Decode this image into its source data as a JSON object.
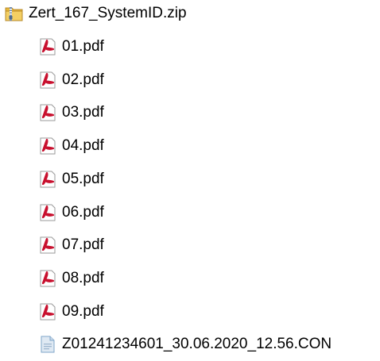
{
  "archive": {
    "name": "Zert_167_SystemID.zip",
    "icon": "zip-folder-icon"
  },
  "files": [
    {
      "name": "01.pdf",
      "icon": "pdf-file-icon"
    },
    {
      "name": "02.pdf",
      "icon": "pdf-file-icon"
    },
    {
      "name": "03.pdf",
      "icon": "pdf-file-icon"
    },
    {
      "name": "04.pdf",
      "icon": "pdf-file-icon"
    },
    {
      "name": "05.pdf",
      "icon": "pdf-file-icon"
    },
    {
      "name": "06.pdf",
      "icon": "pdf-file-icon"
    },
    {
      "name": "07.pdf",
      "icon": "pdf-file-icon"
    },
    {
      "name": "08.pdf",
      "icon": "pdf-file-icon"
    },
    {
      "name": "09.pdf",
      "icon": "pdf-file-icon"
    },
    {
      "name": "Z01241234601_30.06.2020_12.56.CON",
      "icon": "generic-file-icon"
    }
  ],
  "colors": {
    "pdf_red": "#c8102e",
    "folder_yellow": "#e8b93a",
    "generic_file_blue": "#7fa6c9"
  }
}
